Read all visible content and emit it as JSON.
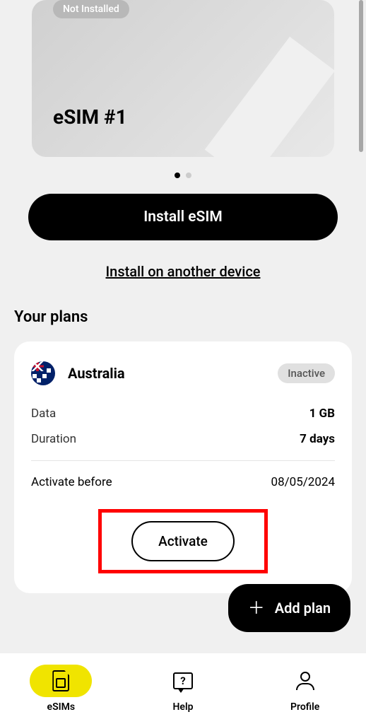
{
  "esim_card": {
    "status": "Not Installed",
    "title": "eSIM #1"
  },
  "actions": {
    "install_button": "Install eSIM",
    "install_other": "Install on another device"
  },
  "plans_section": {
    "title": "Your plans"
  },
  "plan": {
    "country": "Australia",
    "status": "Inactive",
    "data_label": "Data",
    "data_value": "1 GB",
    "duration_label": "Duration",
    "duration_value": "7 days",
    "activate_before_label": "Activate before",
    "activate_before_value": "08/05/2024",
    "activate_button": "Activate"
  },
  "add_plan_button": "Add plan",
  "nav": {
    "esims": "eSIMs",
    "help": "Help",
    "profile": "Profile"
  }
}
